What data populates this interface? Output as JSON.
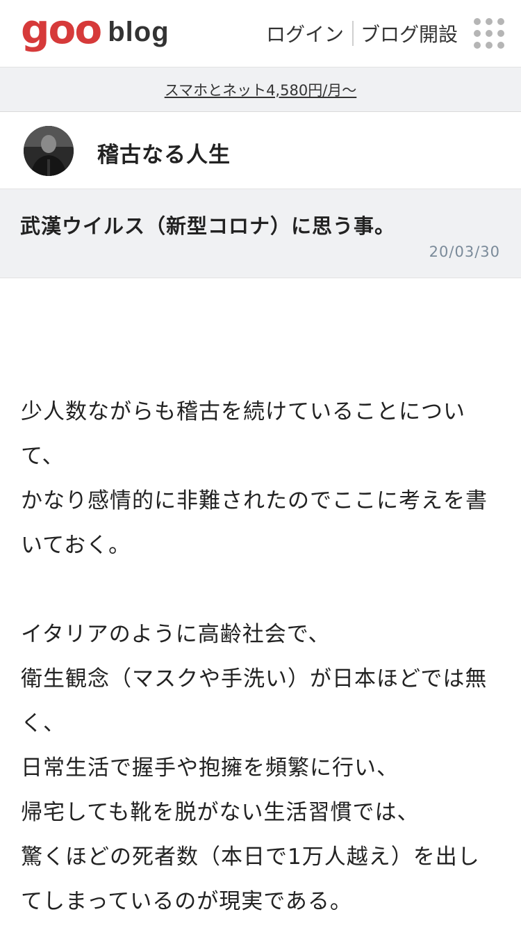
{
  "header": {
    "logo_goo": "goo",
    "logo_blog": "blog",
    "login_label": "ログイン",
    "open_blog_label": "ブログ開設",
    "menu_icon": "grid-menu-icon",
    "brand_color": "#d63a3a"
  },
  "promo": {
    "text": "スマホとネット4,580円/月～"
  },
  "blog": {
    "title": "稽古なる人生",
    "avatar_icon": "author-avatar"
  },
  "entry": {
    "title": "武漢ウイルス（新型コロナ）に思う事。",
    "date": "20/03/30",
    "paragraph_1": [
      "少人数ながらも稽古を続けていることについて、",
      "かなり感情的に非難されたのでここに考えを書いておく。"
    ],
    "paragraph_2": [
      "イタリアのように高齢社会で、",
      "衛生観念（マスクや手洗い）が日本ほどでは無く、",
      "日常生活で握手や抱擁を頻繁に行い、",
      "帰宅しても靴を脱がない生活習慣では、",
      "驚くほどの死者数（本日で1万人越え）を出してしまっているのが現実である。"
    ]
  }
}
